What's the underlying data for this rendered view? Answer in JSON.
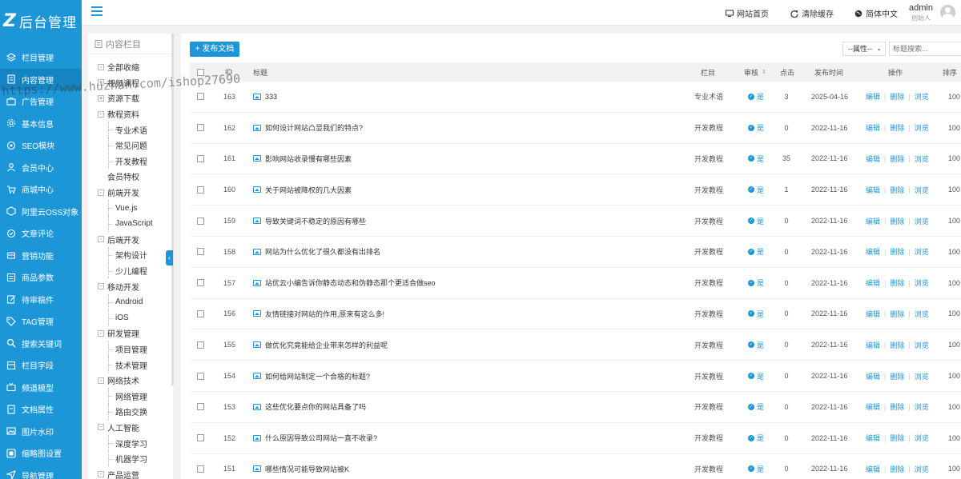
{
  "app": {
    "logo_mark": "Z",
    "logo_text": "后台管理"
  },
  "sidebar": {
    "items": [
      {
        "label": "栏目管理",
        "icon": "layers-icon"
      },
      {
        "label": "内容管理",
        "icon": "document-icon",
        "active": true
      },
      {
        "label": "广告管理",
        "icon": "ad-icon"
      },
      {
        "label": "基本信息",
        "icon": "gear-icon"
      },
      {
        "label": "SEO模块",
        "icon": "seo-icon"
      },
      {
        "label": "会员中心",
        "icon": "user-icon"
      },
      {
        "label": "商城中心",
        "icon": "cart-icon"
      },
      {
        "label": "阿里云OSS对象",
        "icon": "cloud-box-icon"
      },
      {
        "label": "文章评论",
        "icon": "comment-icon"
      },
      {
        "label": "营销功能",
        "icon": "gift-icon"
      },
      {
        "label": "商品参数",
        "icon": "list-icon"
      },
      {
        "label": "待审稿件",
        "icon": "edit-icon"
      },
      {
        "label": "TAG管理",
        "icon": "tag-icon"
      },
      {
        "label": "搜索关键词",
        "icon": "search-icon"
      },
      {
        "label": "栏目字段",
        "icon": "field-icon"
      },
      {
        "label": "频道模型",
        "icon": "tv-icon"
      },
      {
        "label": "文档属性",
        "icon": "doc-attr-icon"
      },
      {
        "label": "图片水印",
        "icon": "image-icon"
      },
      {
        "label": "缩略图设置",
        "icon": "thumb-icon"
      },
      {
        "label": "导航管理",
        "icon": "nav-icon"
      }
    ]
  },
  "header": {
    "links": [
      {
        "label": "网站首页",
        "icon": "monitor-icon"
      },
      {
        "label": "清除缓存",
        "icon": "refresh-icon"
      },
      {
        "label": "简体中文",
        "icon": "globe-icon"
      }
    ],
    "user": {
      "name": "admin",
      "role": "创始人"
    }
  },
  "tree": {
    "title": "内容栏目",
    "rows": [
      {
        "label": "全部收缩",
        "kind": "toggle",
        "sign": "-"
      },
      {
        "label": "视频课程",
        "kind": "toggle",
        "sign": "+"
      },
      {
        "label": "资源下载",
        "kind": "toggle",
        "sign": "+"
      },
      {
        "label": "教程资料",
        "kind": "toggle",
        "sign": "-"
      },
      {
        "label": "专业术语",
        "kind": "child"
      },
      {
        "label": "常见问题",
        "kind": "child"
      },
      {
        "label": "开发教程",
        "kind": "child"
      },
      {
        "label": "会员特权",
        "kind": "plain"
      },
      {
        "label": "前端开发",
        "kind": "toggle",
        "sign": "-"
      },
      {
        "label": "Vue.js",
        "kind": "child"
      },
      {
        "label": "JavaScript",
        "kind": "child"
      },
      {
        "label": "后端开发",
        "kind": "toggle",
        "sign": "-"
      },
      {
        "label": "架构设计",
        "kind": "child"
      },
      {
        "label": "少儿编程",
        "kind": "child"
      },
      {
        "label": "移动开发",
        "kind": "toggle",
        "sign": "-"
      },
      {
        "label": "Android",
        "kind": "child"
      },
      {
        "label": "iOS",
        "kind": "child"
      },
      {
        "label": "研发管理",
        "kind": "toggle",
        "sign": "-"
      },
      {
        "label": "项目管理",
        "kind": "child"
      },
      {
        "label": "技术管理",
        "kind": "child"
      },
      {
        "label": "网络技术",
        "kind": "toggle",
        "sign": "-"
      },
      {
        "label": "网络管理",
        "kind": "child"
      },
      {
        "label": "路由交换",
        "kind": "child"
      },
      {
        "label": "人工智能",
        "kind": "toggle",
        "sign": "-"
      },
      {
        "label": "深度学习",
        "kind": "child"
      },
      {
        "label": "机器学习",
        "kind": "child"
      },
      {
        "label": "产品运营",
        "kind": "toggle",
        "sign": "-"
      }
    ]
  },
  "toolbar": {
    "publish_label": "+ 发布文档",
    "attr_select": "--属性--",
    "search_placeholder": "标题搜索..."
  },
  "table": {
    "headers": {
      "id": "ID",
      "title": "标题",
      "column": "栏目",
      "audit": "审核",
      "clicks": "点击",
      "date": "发布时间",
      "ops": "操作",
      "sort": "排序"
    },
    "status_label": "是",
    "op_edit": "编辑",
    "op_delete": "删除",
    "op_view": "浏览",
    "rows": [
      {
        "id": "163",
        "title": "333",
        "column": "专业术语",
        "clicks": "3",
        "date": "2025-04-16",
        "sort": "100"
      },
      {
        "id": "162",
        "title": "如何设计网站凸显我们的特点?",
        "column": "开发教程",
        "clicks": "0",
        "date": "2022-11-16",
        "sort": "100"
      },
      {
        "id": "161",
        "title": "影响网站收录慢有哪些因素",
        "column": "开发教程",
        "clicks": "35",
        "date": "2022-11-16",
        "sort": "100"
      },
      {
        "id": "160",
        "title": "关于网站被降权的几大因素",
        "column": "开发教程",
        "clicks": "1",
        "date": "2022-11-16",
        "sort": "100"
      },
      {
        "id": "159",
        "title": "导致关键词不稳定的原因有哪些",
        "column": "开发教程",
        "clicks": "0",
        "date": "2022-11-16",
        "sort": "100"
      },
      {
        "id": "158",
        "title": "网站为什么优化了很久都没有出排名",
        "column": "开发教程",
        "clicks": "0",
        "date": "2022-11-16",
        "sort": "100"
      },
      {
        "id": "157",
        "title": "站优云小编告诉你静态动态和伪静态那个更适合做seo",
        "column": "开发教程",
        "clicks": "0",
        "date": "2022-11-16",
        "sort": "100"
      },
      {
        "id": "156",
        "title": "友情链接对网站的作用,原来有这么多!",
        "column": "开发教程",
        "clicks": "0",
        "date": "2022-11-16",
        "sort": "100"
      },
      {
        "id": "155",
        "title": "做优化究竟能给企业带来怎样的利益呢",
        "column": "开发教程",
        "clicks": "0",
        "date": "2022-11-16",
        "sort": "100"
      },
      {
        "id": "154",
        "title": "如何给网站制定一个合格的标题?",
        "column": "开发教程",
        "clicks": "0",
        "date": "2022-11-16",
        "sort": "100"
      },
      {
        "id": "153",
        "title": "这些优化要点你的网站具备了吗",
        "column": "开发教程",
        "clicks": "0",
        "date": "2022-11-16",
        "sort": "100"
      },
      {
        "id": "152",
        "title": "什么原因导致公司网站一直不收录?",
        "column": "开发教程",
        "clicks": "0",
        "date": "2022-11-16",
        "sort": "100"
      },
      {
        "id": "151",
        "title": "哪些情况可能导致网站被K",
        "column": "开发教程",
        "clicks": "0",
        "date": "2022-11-16",
        "sort": "100"
      }
    ]
  },
  "watermark": "https://www.huzhan.com/ishop27690",
  "colors": {
    "accent": "#1d96d8",
    "sidebar_bg": "#1d96d8",
    "sidebar_active": "#1584c3"
  }
}
